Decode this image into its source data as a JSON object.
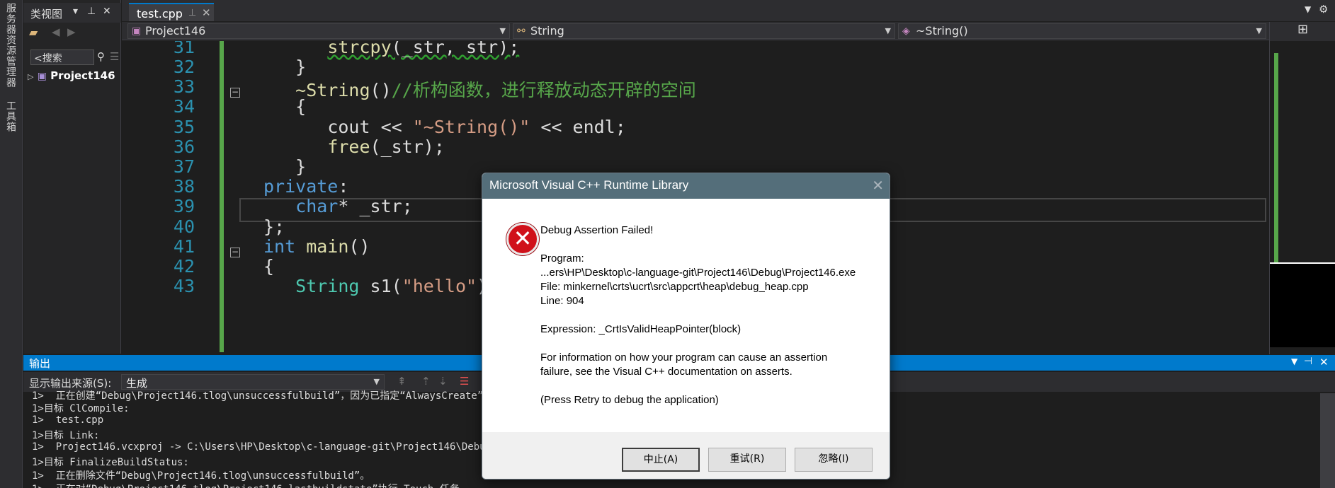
{
  "left_strip": {
    "tabs": [
      "服务器资源管理器",
      "工具箱"
    ]
  },
  "class_view": {
    "title": "类视图",
    "search_placeholder": "<搜索",
    "tree_item": "Project146"
  },
  "editor": {
    "file_tab": "test.cpp",
    "nav": {
      "project": "Project146",
      "class": "String",
      "member": "~String()"
    },
    "line_numbers": [
      "31",
      "32",
      "33",
      "34",
      "35",
      "36",
      "37",
      "38",
      "39",
      "40",
      "41",
      "42",
      "43"
    ]
  },
  "code": {
    "l31_fn": "strcpy",
    "l31_rest": "(_str, str);",
    "l32": "}",
    "l33_fn": "~String",
    "l33_paren": "()",
    "l33_comment": "//析构函数，进行释放动态开辟的空间",
    "l34": "{",
    "l35_a": "cout << ",
    "l35_str": "\"~String()\"",
    "l35_b": " << endl;",
    "l36_fn": "free",
    "l36_rest": "(_str);",
    "l37": "}",
    "l38_kw": "private",
    "l38_rest": ":",
    "l39_kw": "char",
    "l39_rest": "* _str;",
    "l40": "};",
    "l41_kw": "int",
    "l41_fn": " main",
    "l41_rest": "()",
    "l42": "{",
    "l43_ty": "String",
    "l43_a": " s1(",
    "l43_str": "\"hello\"",
    "l43_b": ");"
  },
  "output": {
    "title": "输出",
    "source_label": "显示输出来源(S):",
    "source_value": "生成",
    "lines": [
      "1>  正在创建“Debug\\Project146.tlog\\unsuccessfulbuild”，因为已指定“AlwaysCreate”。",
      "1>目标 ClCompile:",
      "1>  test.cpp",
      "1>目标 Link:",
      "1>  Project146.vcxproj -> C:\\Users\\HP\\Desktop\\c-language-git\\Project146\\Debug\\",
      "1>目标 FinalizeBuildStatus:",
      "1>  正在删除文件“Debug\\Project146.tlog\\unsuccessfulbuild”。",
      "1>  正在对“Debug\\Project146.tlog\\Project146.lastbuildstate”执行 Touch 任务。"
    ]
  },
  "dialog": {
    "title": "Microsoft Visual C++ Runtime Library",
    "heading": "Debug Assertion Failed!",
    "program_label": "Program:",
    "program_path": "...ers\\HP\\Desktop\\c-language-git\\Project146\\Debug\\Project146.exe",
    "file_line": "File: minkernel\\crts\\ucrt\\src\\appcrt\\heap\\debug_heap.cpp",
    "line_line": "Line: 904",
    "expression": "Expression: _CrtIsValidHeapPointer(block)",
    "info_1": "For information on how your program can cause an assertion",
    "info_2": "failure, see the Visual C++ documentation on asserts.",
    "press_retry": "(Press Retry to debug the application)",
    "buttons": {
      "abort": "中止(A)",
      "retry": "重试(R)",
      "ignore": "忽略(I)"
    }
  }
}
